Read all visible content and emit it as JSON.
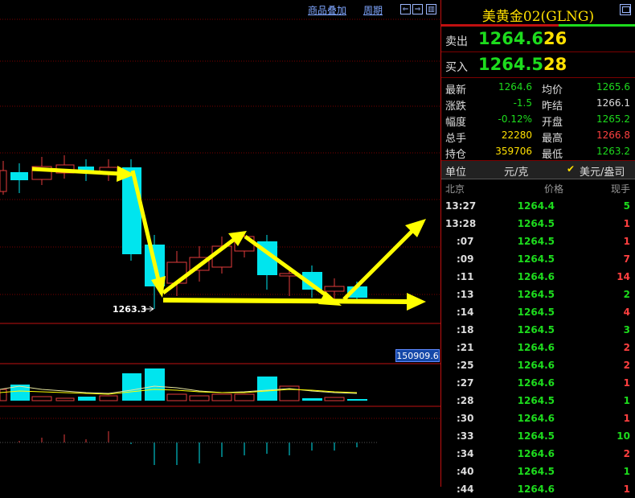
{
  "toolbar": {
    "overlay_label": "商品叠加",
    "period_label": "周期"
  },
  "chart": {
    "price_label": "1263.3",
    "volume_badge": "150909.6",
    "colors": {
      "up": "#e33b3b",
      "down": "#00e5ee",
      "arrow": "#ffff00",
      "ma": "#e8e8a0",
      "grid": "#7a0000"
    }
  },
  "panel": {
    "title": "美黄金02(GLNG)",
    "sell": {
      "label": "卖出",
      "price": "1264.6",
      "qty": "26"
    },
    "buy": {
      "label": "买入",
      "price": "1264.5",
      "qty": "28"
    },
    "quote_rows": [
      {
        "l1": "最新",
        "v1": "1264.6",
        "c1": "#1ddc1d",
        "l2": "均价",
        "v2": "1265.6",
        "c2": "#1ddc1d"
      },
      {
        "l1": "涨跌",
        "v1": "-1.5",
        "c1": "#1ddc1d",
        "l2": "昨结",
        "v2": "1266.1",
        "c2": "#dddddd"
      },
      {
        "l1": "幅度",
        "v1": "-0.12%",
        "c1": "#1ddc1d",
        "l2": "开盘",
        "v2": "1265.2",
        "c2": "#1ddc1d"
      },
      {
        "l1": "总手",
        "v1": "22280",
        "c1": "#ffe000",
        "l2": "最高",
        "v2": "1266.8",
        "c2": "#ff4040"
      },
      {
        "l1": "持仓",
        "v1": "359706",
        "c1": "#ffe000",
        "l2": "最低",
        "v2": "1263.2",
        "c2": "#1ddc1d"
      }
    ],
    "unit": {
      "label": "单位",
      "value": "元/克",
      "toggle": "美元/盎司"
    },
    "ticks_header": {
      "time": "北京",
      "price": "价格",
      "qty": "现手"
    },
    "ticks": [
      {
        "time": "13:27",
        "price": "1264.4",
        "qty": "5",
        "qc": "#1ddc1d"
      },
      {
        "time": "13:28",
        "price": "1264.5",
        "qty": "1",
        "qc": "#ff4040"
      },
      {
        "time": ":07",
        "price": "1264.5",
        "qty": "1",
        "qc": "#ff4040"
      },
      {
        "time": ":09",
        "price": "1264.5",
        "qty": "7",
        "qc": "#ff4040"
      },
      {
        "time": ":11",
        "price": "1264.6",
        "qty": "14",
        "qc": "#ff4040"
      },
      {
        "time": ":13",
        "price": "1264.5",
        "qty": "2",
        "qc": "#1ddc1d"
      },
      {
        "time": ":14",
        "price": "1264.5",
        "qty": "4",
        "qc": "#ff4040"
      },
      {
        "time": ":18",
        "price": "1264.5",
        "qty": "3",
        "qc": "#1ddc1d"
      },
      {
        "time": ":21",
        "price": "1264.6",
        "qty": "2",
        "qc": "#ff4040"
      },
      {
        "time": ":25",
        "price": "1264.6",
        "qty": "2",
        "qc": "#ff4040"
      },
      {
        "time": ":27",
        "price": "1264.6",
        "qty": "1",
        "qc": "#ff4040"
      },
      {
        "time": ":28",
        "price": "1264.5",
        "qty": "1",
        "qc": "#1ddc1d"
      },
      {
        "time": ":30",
        "price": "1264.6",
        "qty": "1",
        "qc": "#ff4040"
      },
      {
        "time": ":33",
        "price": "1264.5",
        "qty": "10",
        "qc": "#1ddc1d"
      },
      {
        "time": ":34",
        "price": "1264.6",
        "qty": "2",
        "qc": "#ff4040"
      },
      {
        "time": ":40",
        "price": "1264.5",
        "qty": "1",
        "qc": "#1ddc1d"
      },
      {
        "time": ":44",
        "price": "1264.6",
        "qty": "1",
        "qc": "#ff4040"
      }
    ]
  }
}
